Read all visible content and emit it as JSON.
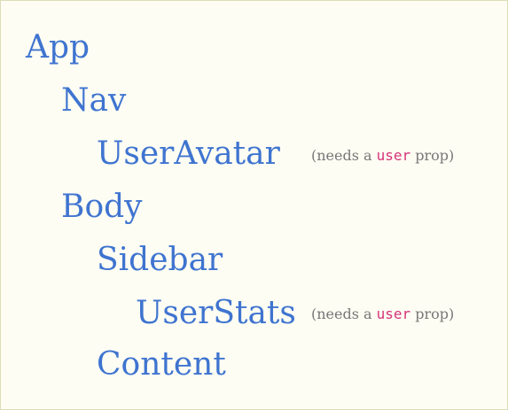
{
  "colors": {
    "node": "#3f74d0",
    "note": "#777777",
    "code": "#d6337a",
    "background": "#fdfdf3"
  },
  "tree": {
    "app": "App",
    "nav": "Nav",
    "user_avatar": "UserAvatar",
    "body": "Body",
    "sidebar": "Sidebar",
    "user_stats": "UserStats",
    "content": "Content"
  },
  "notes": {
    "user_avatar": {
      "before": "(needs a ",
      "code": "user",
      "after": " prop)"
    },
    "user_stats": {
      "before": "(needs a ",
      "code": "user",
      "after": " prop)"
    }
  }
}
